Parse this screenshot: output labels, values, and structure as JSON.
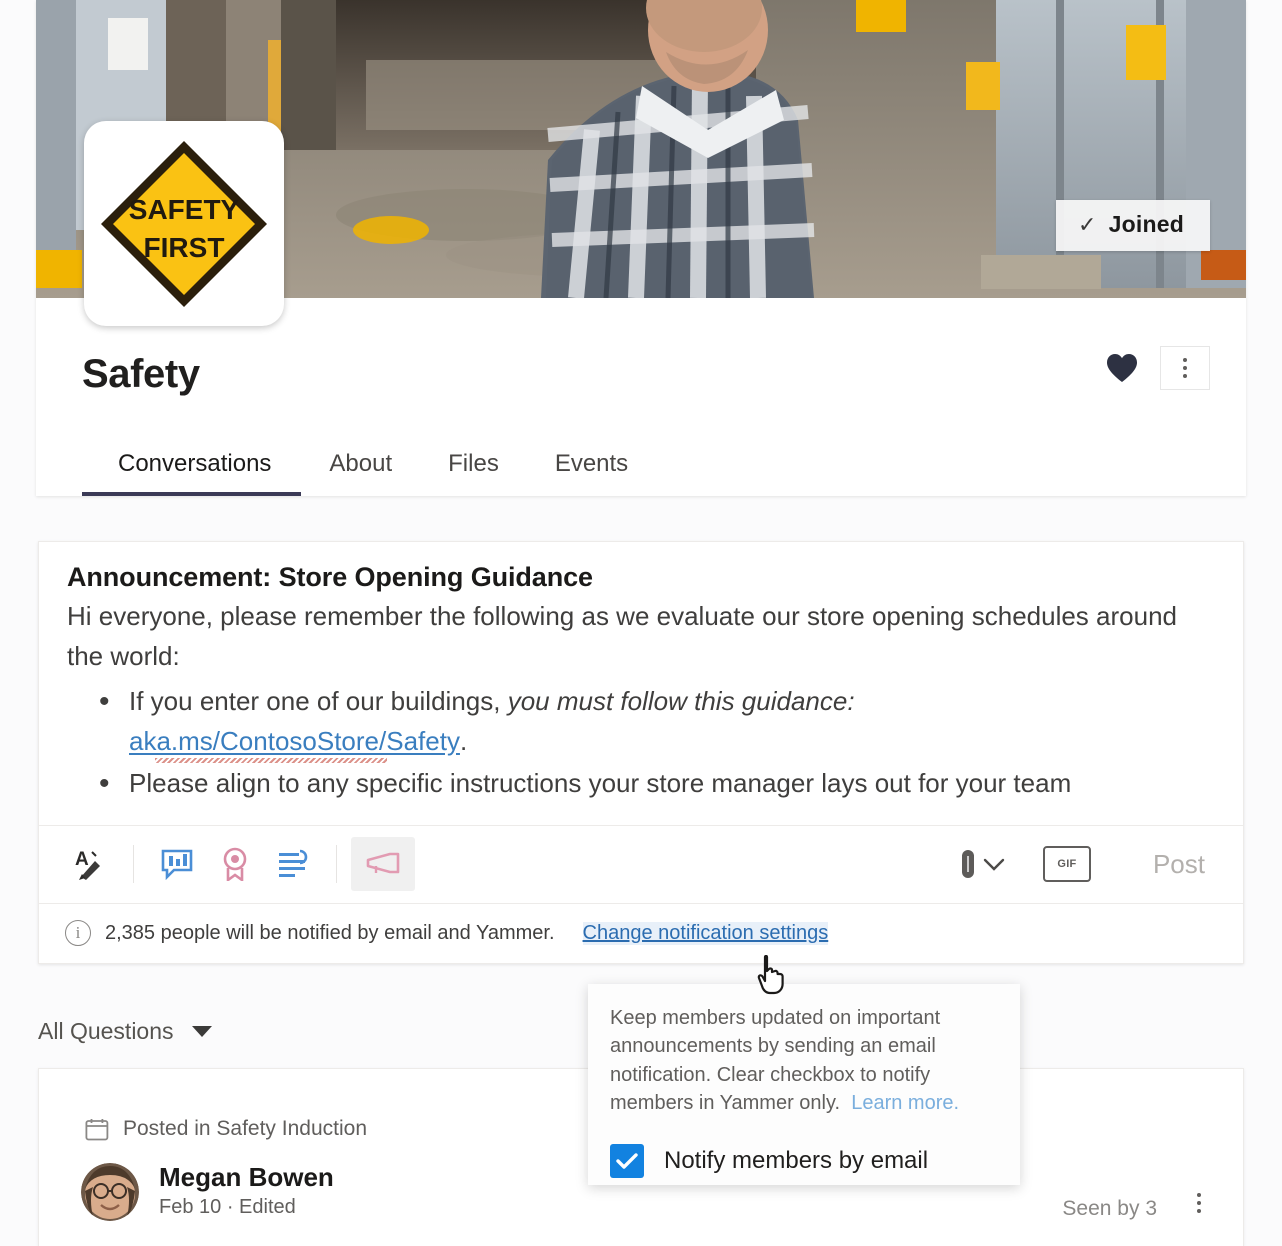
{
  "group": {
    "name": "Safety",
    "logo_text_line1": "SAFETY",
    "logo_text_line2": "FIRST",
    "joined_label": "Joined",
    "joined_icon": "checkmark-icon",
    "favorite_icon": "heart-filled-icon",
    "more_icon": "kebab-menu-icon",
    "cover_alt": "warehouse-cover-photo"
  },
  "tabs": [
    {
      "label": "Conversations",
      "active": true
    },
    {
      "label": "About",
      "active": false
    },
    {
      "label": "Files",
      "active": false
    },
    {
      "label": "Events",
      "active": false
    }
  ],
  "composer": {
    "title": "Announcement: Store Opening Guidance",
    "paragraph": "Hi everyone, please remember the following as we evaluate our store opening schedules around the world:",
    "bullets": [
      {
        "lead": "If you enter one of our buildings, ",
        "emphasis": "you must follow this guidance:",
        "link": "aka.ms/ContosoStore/Safety",
        "trail": "."
      },
      {
        "lead": "Please align to any specific instructions your store manager lays out for your team",
        "emphasis": "",
        "link": "",
        "trail": ""
      }
    ],
    "toolbar": {
      "format_icon": "format-text-icon",
      "poll_icon": "poll-icon",
      "praise_icon": "praise-badge-icon",
      "question_icon": "question-icon",
      "announcement_icon": "announcement-megaphone-icon",
      "attach_icon": "paperclip-icon",
      "attach_chevron_icon": "chevron-down-icon",
      "gif_icon": "gif-icon",
      "gif_label": "GIF",
      "post_label": "Post"
    },
    "notify": {
      "info_icon": "info-circle-icon",
      "text": "2,385 people will be notified by email and Yammer.",
      "link": "Change notification settings"
    }
  },
  "popover": {
    "body": "Keep members updated on important announcements by sending an email notification.  Clear checkbox to notify members in Yammer only.",
    "learn_more": "Learn more.",
    "checkbox_label": "Notify members by email",
    "checkbox_checked": true,
    "check_icon": "checkmark-icon"
  },
  "filter": {
    "label": "All Questions",
    "caret_icon": "chevron-down-icon"
  },
  "feed": {
    "posted_in_icon": "calendar-icon",
    "posted_in": "Posted in Safety Induction",
    "author": "Megan Bowen",
    "author_avatar": "user-avatar",
    "meta": "Feb 10  ·  Edited",
    "seen_by": "Seen by 3",
    "more_icon": "kebab-menu-icon"
  },
  "colors": {
    "accent_blue": "#1282e0",
    "link_blue": "#2b6cb0",
    "sign_yellow": "#fac213",
    "tab_underline": "#3b3a56"
  }
}
